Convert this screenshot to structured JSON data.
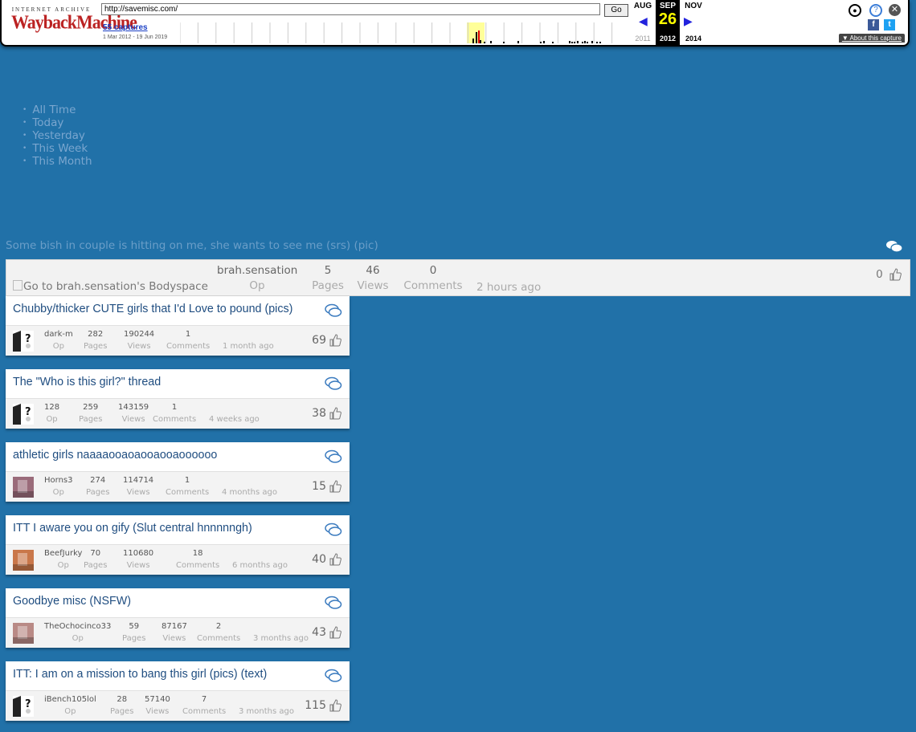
{
  "wayback": {
    "logo_top": "INTERNET ARCHIVE",
    "logo_main": "WaybackMachine",
    "url": "http://savemisc.com/",
    "go_label": "Go",
    "captures_link": "55 captures",
    "captures_range": "1 Mar 2012 - 19 Jun 2019",
    "months": {
      "prev": "AUG",
      "current": "SEP",
      "next": "NOV"
    },
    "day": "26",
    "years": {
      "prev": "2011",
      "current": "2012",
      "next": "2014"
    },
    "about": "About this capture",
    "facebook": "f",
    "twitter": "t"
  },
  "time_filter": [
    "All Time",
    "Today",
    "Yesterday",
    "This Week",
    "This Month"
  ],
  "first_thread": {
    "title": "Some bish in couple is hitting on me, she wants to see me (srs) (pic)",
    "avatar_alt": "Go to brah.sensation's Bodyspace",
    "op": "brah.sensation",
    "op_label": "Op",
    "pages": "5",
    "pages_label": "Pages",
    "views": "46",
    "views_label": "Views",
    "comments": "0",
    "comments_label": "Comments",
    "ago": "2 hours ago",
    "likes": "0"
  },
  "threads": [
    {
      "title": "Chubby/thicker CUTE girls that I'd Love to pound (pics)",
      "user": "dark-m",
      "pages": "282",
      "views": "190244",
      "comments": "1",
      "ago": "1 month ago",
      "likes": "69",
      "avatar": "question"
    },
    {
      "title": "The \"Who is this girl?\" thread",
      "user": "128",
      "pages": "259",
      "views": "143159",
      "comments": "1",
      "ago": "4 weeks ago",
      "likes": "38",
      "avatar": "question"
    },
    {
      "title": "athletic girls naaaaooaoaooaooaoooooo",
      "user": "Horns3",
      "pages": "274",
      "views": "114714",
      "comments": "1",
      "ago": "4 months ago",
      "likes": "15",
      "avatar": "photo"
    },
    {
      "title": "ITT I aware you on gify (Slut central hnnnnngh)",
      "user": "BeefJurky",
      "pages": "70",
      "views": "110680",
      "comments": "18",
      "ago": "6 months ago",
      "likes": "40",
      "avatar": "photo"
    },
    {
      "title": "Goodbye misc (NSFW)",
      "user": "TheOchocinco33",
      "pages": "59",
      "views": "87167",
      "comments": "2",
      "ago": "3 months ago",
      "likes": "43",
      "avatar": "photo"
    },
    {
      "title": "ITT: I am on a mission to bang this girl (pics) (text)",
      "user": "iBench105lol",
      "pages": "28",
      "views": "57140",
      "comments": "7",
      "ago": "3 months ago",
      "likes": "115",
      "avatar": "question"
    }
  ],
  "labels": {
    "op": "Op",
    "pages": "Pages",
    "views": "Views",
    "comments": "Comments"
  },
  "colors": {
    "background": "#2171a8",
    "title": "#1f4d80",
    "wayback_red": "#b22222"
  }
}
